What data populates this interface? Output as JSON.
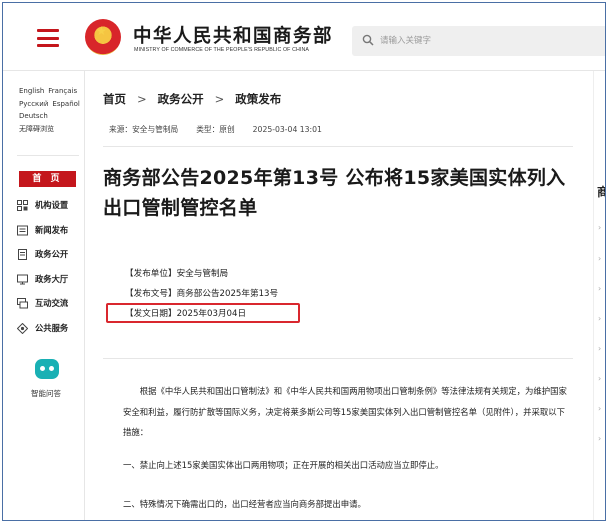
{
  "header": {
    "site_title": "中华人民共和国商务部",
    "site_subtitle": "MINISTRY OF COMMERCE OF THE PEOPLE'S REPUBLIC OF CHINA",
    "search_placeholder": "请输入关键字",
    "brand_color": "#c4161c"
  },
  "sidebar": {
    "languages": [
      [
        "English",
        "Français"
      ],
      [
        "Русский",
        "Español"
      ],
      [
        "Deutsch"
      ],
      [
        "无障碍浏览"
      ]
    ],
    "home_label": "首 页",
    "items": [
      {
        "label": "机构设置",
        "icon": "org-icon"
      },
      {
        "label": "新闻发布",
        "icon": "news-icon"
      },
      {
        "label": "政务公开",
        "icon": "document-icon"
      },
      {
        "label": "政务大厅",
        "icon": "hall-icon"
      },
      {
        "label": "互动交流",
        "icon": "chat-icon"
      },
      {
        "label": "公共服务",
        "icon": "service-icon"
      }
    ],
    "assistant_label": "智能问答"
  },
  "main": {
    "breadcrumb": [
      "首页",
      "政务公开",
      "政策发布"
    ],
    "meta": {
      "source": "来源：安全与管制局",
      "type": "类型：原创",
      "datetime": "2025-03-04 13:01"
    },
    "title": "商务部公告2025年第13号 公布将15家美国实体列入出口管制管控名单",
    "fields": {
      "unit": "【发布单位】安全与管制局",
      "doc_no": "【发布文号】商务部公告2025年第13号",
      "date": "【发文日期】2025年03月04日"
    },
    "body": "根据《中华人民共和国出口管制法》和《中华人民共和国两用物项出口管制条例》等法律法规有关规定，为维护国家安全和利益，履行防扩散等国际义务，决定将莱多斯公司等15家美国实体列入出口管制管控名单（见附件），并采取以下措施：",
    "clauses": [
      "一、禁止向上述15家美国实体出口两用物项；正在开展的相关出口活动应当立即停止。",
      "二、特殊情况下确需出口的，出口经营者应当向商务部提出申请。"
    ]
  },
  "right_column": {
    "heading": "商"
  }
}
